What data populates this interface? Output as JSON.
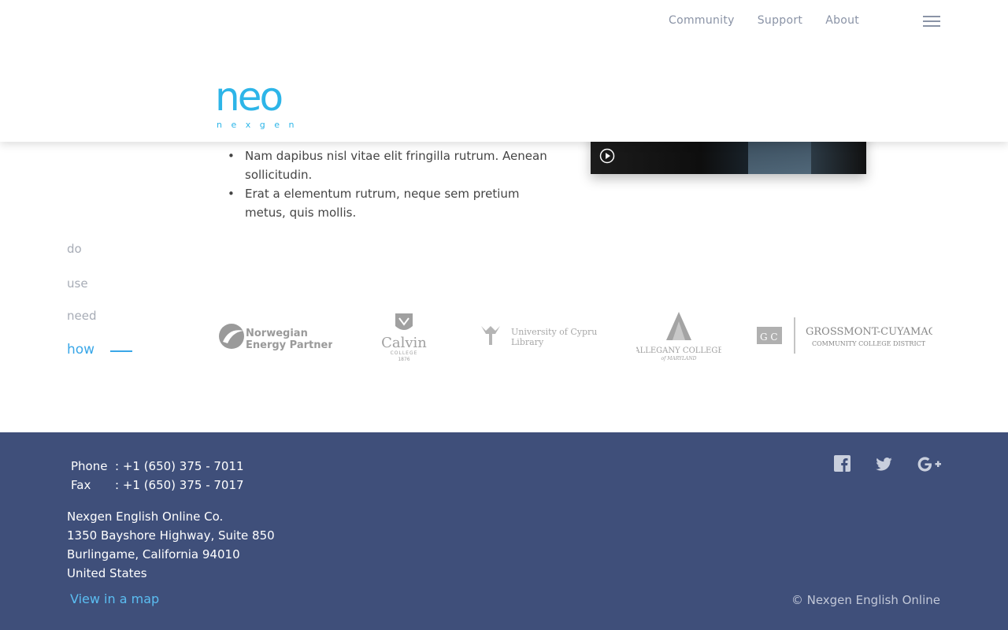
{
  "header": {
    "nav": [
      {
        "label": "Community"
      },
      {
        "label": "Support"
      },
      {
        "label": "About"
      }
    ],
    "logo": {
      "main": "neo",
      "sub": "n e x g e n"
    }
  },
  "content": {
    "bullets": [
      "Nam dapibus nisl vitae elit fringilla rutrum. Aenean sollicitudin.",
      "Erat a elementum rutrum, neque sem pretium metus, quis mollis."
    ]
  },
  "sidenav": {
    "items": [
      {
        "label": "do"
      },
      {
        "label": "use"
      },
      {
        "label": "need"
      },
      {
        "label": "how"
      }
    ],
    "active_index": 3
  },
  "partners": {
    "norwegian": {
      "line1": "Norwegian",
      "line2": "Energy Partners"
    },
    "calvin": {
      "name": "Calvin",
      "sub": "COLLEGE",
      "year": "1876"
    },
    "cyprus": {
      "line1": "University of Cyprus",
      "line2": "Library"
    },
    "allegany": {
      "line1": "ALLEGANY COLLEGE",
      "line2": "of MARYLAND"
    },
    "grossmont": {
      "line1": "GROSSMONT-CUYAMACA",
      "line2": "COMMUNITY COLLEGE DISTRICT",
      "mark": "G C"
    }
  },
  "footer": {
    "phone_label": "Phone",
    "phone_value": ": +1 (650) 375 - 7011",
    "fax_label": "Fax",
    "fax_value": ": +1 (650) 375 - 7017",
    "address": [
      "Nexgen English Online Co.",
      "1350 Bayshore Highway, Suite 850",
      "Burlingame, California 94010",
      "United States"
    ],
    "map_link": "View in a map",
    "copyright": "© Nexgen English Online",
    "social": [
      "facebook-icon",
      "twitter-icon",
      "google-plus-icon"
    ]
  },
  "colors": {
    "accent": "#3aa7e8",
    "footer_bg": "#3f4f7a",
    "nav_text": "#8a93a6"
  }
}
